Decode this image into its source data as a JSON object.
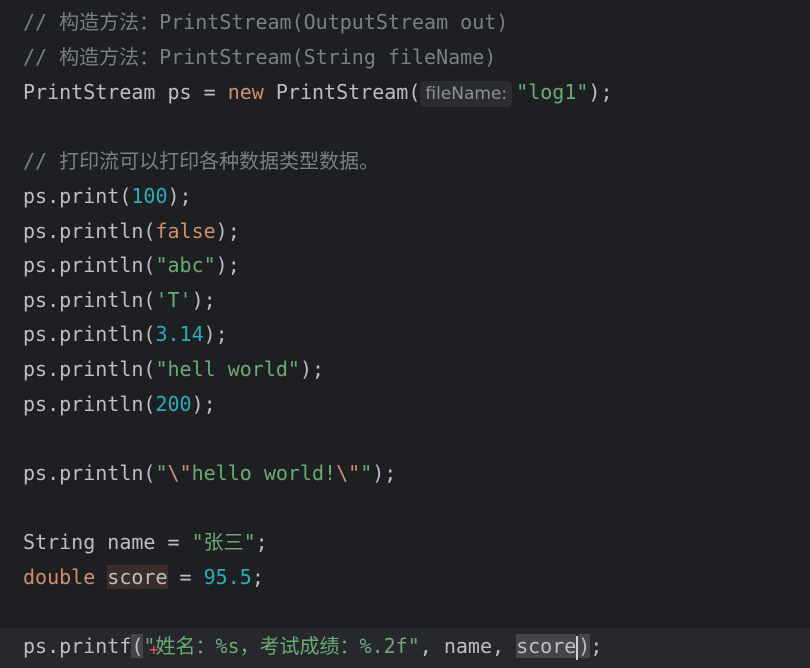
{
  "editor": {
    "lines": {
      "c1": "// 构造方法：PrintStream(OutputStream out)",
      "c2": "// 构造方法：PrintStream(String fileName)",
      "l3_type": "PrintStream",
      "l3_var": " ps = ",
      "l3_new": "new",
      "l3_ctor": " PrintStream(",
      "l3_hint": "fileName:",
      "l3_str": "\"log1\"",
      "l3_end": ");",
      "c4": "// 打印流可以打印各种数据类型数据。",
      "p1_pre": "ps.print(",
      "p1_num": "100",
      "p1_end": ");",
      "p2_pre": "ps.println(",
      "p2_kw": "false",
      "p2_end": ");",
      "p3_pre": "ps.println(",
      "p3_str": "\"abc\"",
      "p3_end": ");",
      "p4_pre": "ps.println(",
      "p4_str": "'T'",
      "p4_end": ");",
      "p5_pre": "ps.println(",
      "p5_num": "3.14",
      "p5_end": ");",
      "p6_pre": "ps.println(",
      "p6_str": "\"hell world\"",
      "p6_end": ");",
      "p7_pre": "ps.println(",
      "p7_num": "200",
      "p7_end": ");",
      "p8_pre": "ps.println(",
      "p8_s1": "\"",
      "p8_e1": "\\\"",
      "p8_s2": "hello world!",
      "p8_e2": "\\\"",
      "p8_s3": "\"",
      "p8_end": ");",
      "d1_type": "String",
      "d1_mid": " name = ",
      "d1_str": "\"张三\"",
      "d1_end": ";",
      "d2_kw": "double",
      "d2_sp": " ",
      "d2_var": "score",
      "d2_mid": " = ",
      "d2_num": "95.5",
      "d2_end": ";",
      "f_pre": "ps.printf",
      "f_open": "(",
      "f_str": "\"姓名：%s，考试成绩：%.2f\"",
      "f_mid": ", name, ",
      "f_var": "score",
      "f_close": ")",
      "f_end": ";"
    }
  },
  "colors": {
    "background": "#1e1f22",
    "comment": "#7a7e85",
    "keyword": "#cf8e6d",
    "number": "#2aacb8",
    "string": "#6aab73",
    "text": "#bcbec4"
  }
}
